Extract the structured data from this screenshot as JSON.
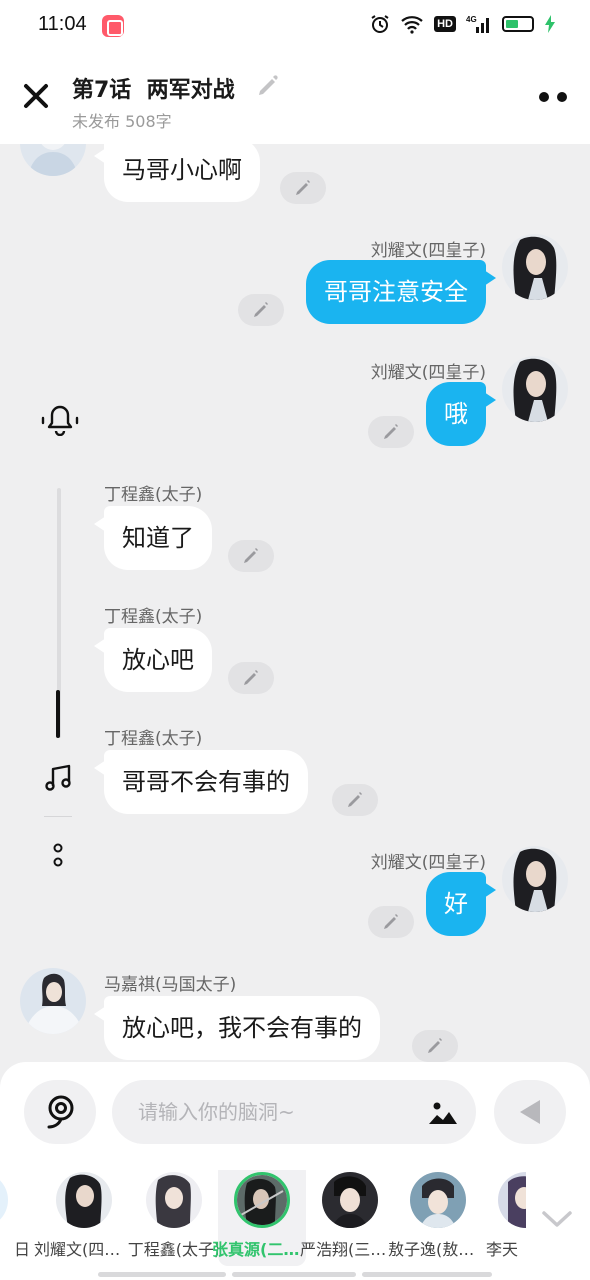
{
  "status_bar": {
    "time": "11:04",
    "network": "4G",
    "hd": "HD"
  },
  "header": {
    "title": "第7话  两军对战",
    "subtitle": "未发布 508字"
  },
  "messages": [
    {
      "side": "left",
      "speaker": "",
      "text": "马哥小心啊"
    },
    {
      "side": "right",
      "speaker": "刘耀文(四皇子)",
      "text": "哥哥注意安全"
    },
    {
      "side": "right",
      "speaker": "刘耀文(四皇子)",
      "text": "哦"
    },
    {
      "side": "left",
      "speaker": "丁程鑫(太子)",
      "text": "知道了"
    },
    {
      "side": "left",
      "speaker": "丁程鑫(太子)",
      "text": "放心吧"
    },
    {
      "side": "left",
      "speaker": "丁程鑫(太子)",
      "text": "哥哥不会有事的"
    },
    {
      "side": "right",
      "speaker": "刘耀文(四皇子)",
      "text": "好"
    },
    {
      "side": "left",
      "speaker": "马嘉祺(马国太子)",
      "text": "放心吧，我不会有事的"
    }
  ],
  "input": {
    "placeholder": "请输入你的脑洞~"
  },
  "characters": [
    {
      "name": "日",
      "selected": false
    },
    {
      "name": "刘耀文(四皇子)",
      "selected": false
    },
    {
      "name": "丁程鑫(太子)",
      "selected": false
    },
    {
      "name": "张真源(二皇子)",
      "selected": true
    },
    {
      "name": "严浩翔(三皇子)",
      "selected": false
    },
    {
      "name": "敖子逸(敖国太子)",
      "selected": false
    },
    {
      "name": "李天",
      "selected": false
    }
  ],
  "colors": {
    "accent_blue": "#1ab4f0",
    "selected_green": "#31c46d",
    "background": "#efeff0"
  }
}
